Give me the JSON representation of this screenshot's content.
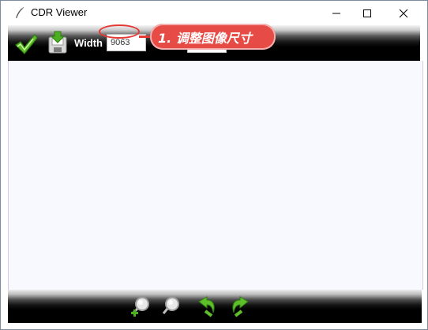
{
  "window": {
    "title": "CDR Viewer",
    "icons": {
      "app": "feather-pen-icon",
      "minimize": "minimize-icon",
      "maximize": "maximize-icon",
      "close": "close-icon"
    }
  },
  "toolbar": {
    "apply_icon": "green-checkmark-icon",
    "save_icon": "save-download-icon",
    "width_label": "Width",
    "width_value": "9063",
    "height_value": ""
  },
  "annotation": {
    "text": "1. 调整图像尺寸",
    "color": "#e64b46"
  },
  "bottombar": {
    "icons": [
      "zoom-in-icon",
      "zoom-out-icon",
      "rotate-left-icon",
      "rotate-right-icon"
    ]
  },
  "colors": {
    "canvas_bg": "#f8f8ff",
    "toolbar_bg": "#000000",
    "icon_green": "#4caf22"
  }
}
